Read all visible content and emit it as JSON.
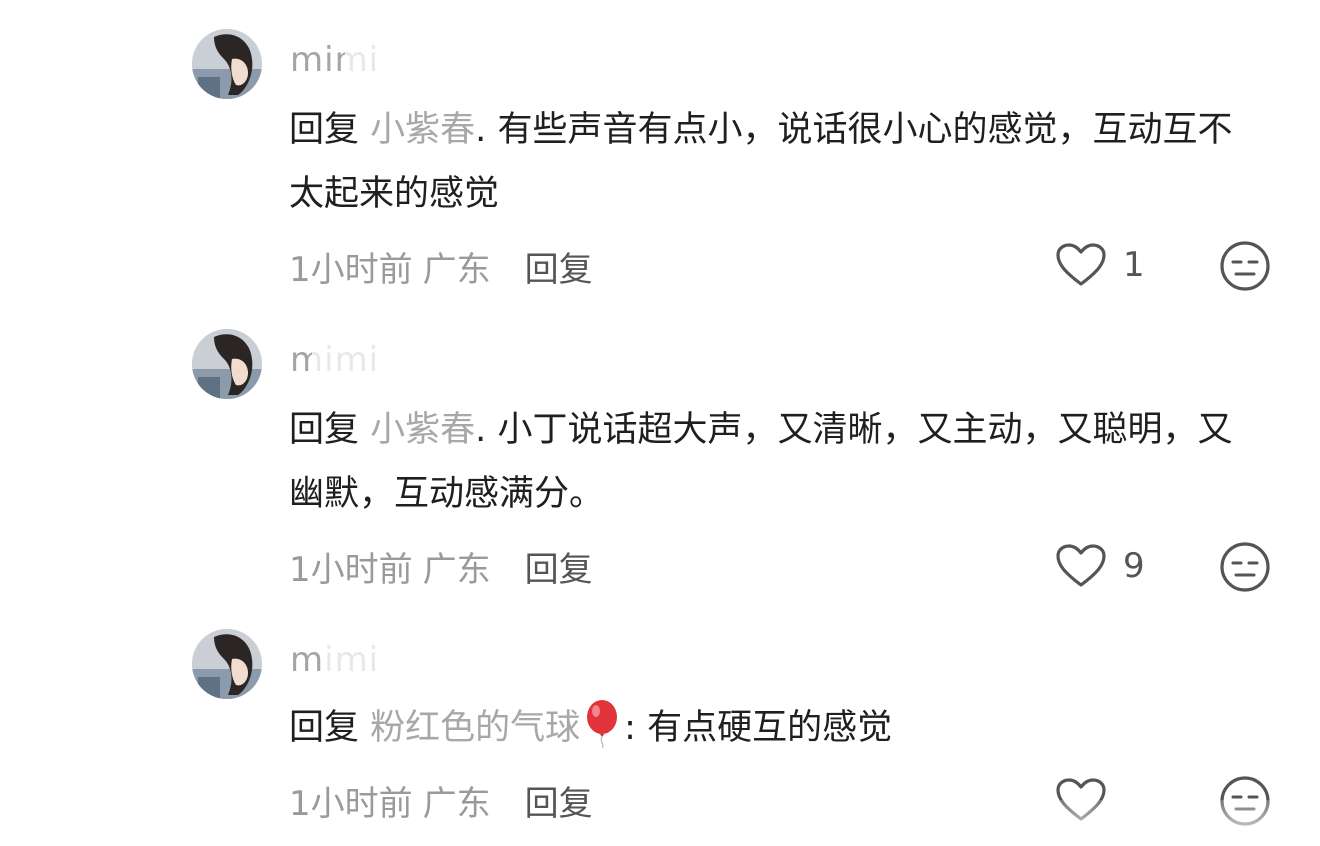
{
  "comments": [
    {
      "username": "mimi",
      "reply_prefix": "回复",
      "reply_target": "小紫春",
      "separator": ".",
      "text": " 有些声音有点小，说话很小心的感觉，互动互不太起来的感觉",
      "time": "1小时前",
      "location": "广东",
      "reply_label": "回复",
      "like_count": "1"
    },
    {
      "username": "mimi",
      "reply_prefix": "回复",
      "reply_target": "小紫春",
      "separator": ".",
      "text": " 小丁说话超大声，又清晰，又主动，又聪明，又幽默，互动感满分。",
      "time": "1小时前",
      "location": "广东",
      "reply_label": "回复",
      "like_count": "9"
    },
    {
      "username": "mimi",
      "reply_prefix": "回复",
      "reply_target": "粉红色的气球",
      "emoji": "balloon-emoji",
      "separator": ":",
      "text": " 有点硬互的感觉",
      "time": "1小时前",
      "location": "广东",
      "reply_label": "回复",
      "like_count": ""
    }
  ],
  "colors": {
    "text": "#1f1f1f",
    "muted": "#9a9a9a",
    "username": "#a5a5a5",
    "icon": "#555555",
    "balloon": "#e0333a"
  }
}
